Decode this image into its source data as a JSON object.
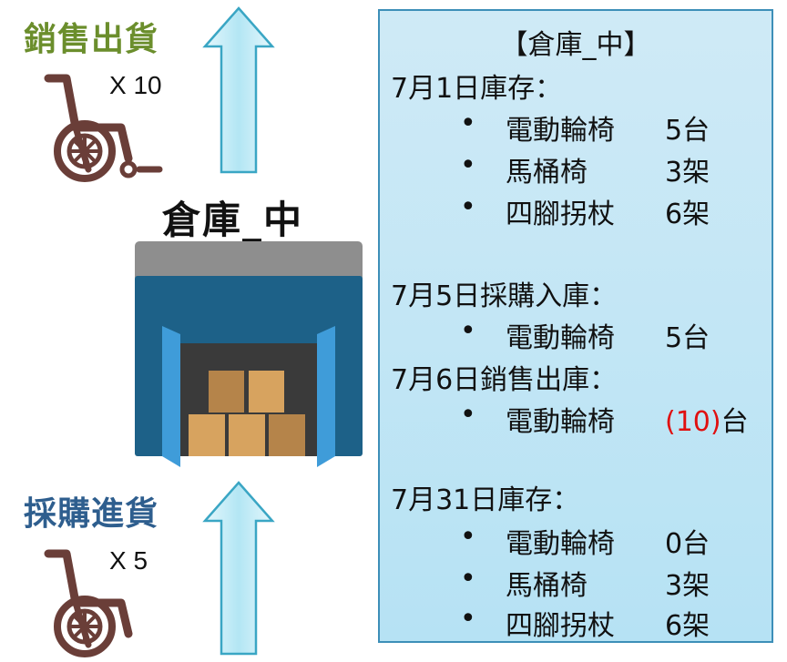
{
  "labels": {
    "sales_out": "銷售出貨",
    "purchase_in": "採購進貨",
    "sales_qty": "X 10",
    "purchase_qty": "X 5",
    "warehouse_name": "倉庫_中"
  },
  "panel": {
    "heading": "【倉庫_中】",
    "bullet": "•",
    "sections": [
      {
        "title": "7月1日庫存：",
        "items": [
          {
            "name": "電動輪椅",
            "value": "5台"
          },
          {
            "name": "馬桶椅",
            "value": "3架"
          },
          {
            "name": "四腳拐杖",
            "value": "6架"
          }
        ]
      },
      {
        "title": "7月5日採購入庫：",
        "items": [
          {
            "name": "電動輪椅",
            "value": "5台"
          }
        ]
      },
      {
        "title": "7月6日銷售出庫：",
        "items": [
          {
            "name": "電動輪椅",
            "value_paren": "(10)",
            "value_unit": "台"
          }
        ]
      },
      {
        "title": "7月31日庫存：",
        "items": [
          {
            "name": "電動輪椅",
            "value": "0台"
          },
          {
            "name": "馬桶椅",
            "value": "3架"
          },
          {
            "name": "四腳拐杖",
            "value": "6架"
          }
        ]
      }
    ]
  },
  "colors": {
    "sales_green": "#6b8e2c",
    "purchase_blue": "#2e5e8e",
    "wheelchair_brown": "#6a3e38",
    "panel_fill": "#c4e6f5",
    "panel_border": "#3d8fb8",
    "arrow_fill": "#c8eef8",
    "arrow_stroke": "#3aa6c4",
    "negative_red": "#e01010"
  },
  "icons": [
    "wheelchair-icon",
    "up-arrow-icon",
    "warehouse-icon",
    "box-icon"
  ]
}
